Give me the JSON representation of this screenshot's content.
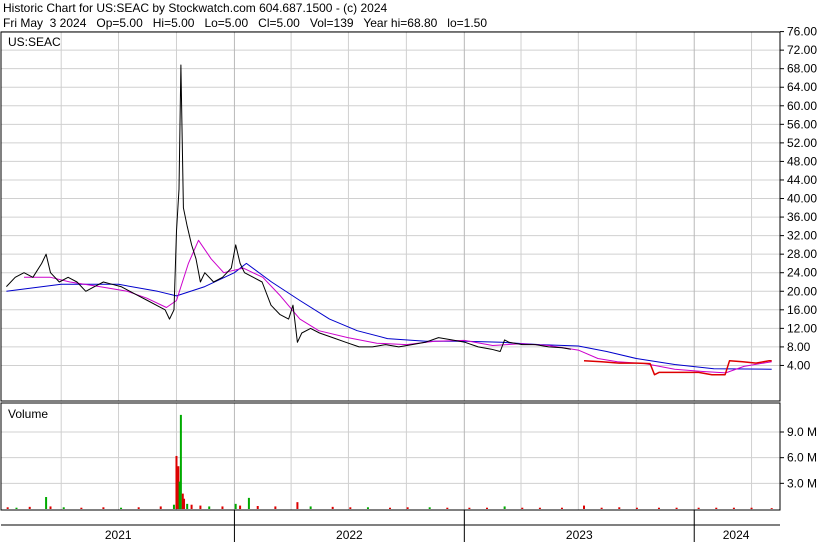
{
  "header": {
    "title": "Historic Chart for US:SEAC by Stockwatch.com 604.687.1500 - (c) 2024",
    "quote": "Fri May  3 2024   Op=5.00   Hi=5.00   Lo=5.00   Cl=5.00   Vol=139   Year hi=68.80   lo=1.50"
  },
  "chart_data": [
    {
      "type": "line",
      "title": "US:SEAC",
      "ylim": [
        0,
        78
      ],
      "y_ticks": [
        "76.00",
        "72.00",
        "68.00",
        "64.00",
        "60.00",
        "56.00",
        "52.00",
        "48.00",
        "44.00",
        "40.00",
        "36.00",
        "32.00",
        "28.00",
        "24.00",
        "20.00",
        "16.00",
        "12.00",
        "8.00",
        "4.00"
      ],
      "x_labels": [
        "2021",
        "2022",
        "2023",
        "2024"
      ],
      "grid": true,
      "colors": {
        "price": "#000000",
        "ma_short": "#cc00cc",
        "ma_long": "#0000cc",
        "red_segment": "#dd0000"
      },
      "price": [
        [
          "2021-01-04",
          21
        ],
        [
          "2021-01-18",
          23
        ],
        [
          "2021-02-01",
          24
        ],
        [
          "2021-02-15",
          23
        ],
        [
          "2021-03-01",
          26
        ],
        [
          "2021-03-08",
          28
        ],
        [
          "2021-03-15",
          24
        ],
        [
          "2021-03-29",
          22
        ],
        [
          "2021-04-12",
          23
        ],
        [
          "2021-04-26",
          22
        ],
        [
          "2021-05-10",
          20
        ],
        [
          "2021-05-24",
          21
        ],
        [
          "2021-06-07",
          22
        ],
        [
          "2021-06-21",
          21.5
        ],
        [
          "2021-07-05",
          21
        ],
        [
          "2021-07-19",
          20
        ],
        [
          "2021-08-02",
          19
        ],
        [
          "2021-08-16",
          18
        ],
        [
          "2021-08-30",
          17
        ],
        [
          "2021-09-13",
          16
        ],
        [
          "2021-09-20",
          14
        ],
        [
          "2021-09-27",
          16
        ],
        [
          "2021-10-01",
          33
        ],
        [
          "2021-10-05",
          42
        ],
        [
          "2021-10-08",
          68.8
        ],
        [
          "2021-10-12",
          38
        ],
        [
          "2021-10-18",
          34
        ],
        [
          "2021-10-25",
          30
        ],
        [
          "2021-11-01",
          27
        ],
        [
          "2021-11-08",
          22
        ],
        [
          "2021-11-15",
          24
        ],
        [
          "2021-11-29",
          22
        ],
        [
          "2021-12-13",
          23
        ],
        [
          "2021-12-27",
          25
        ],
        [
          "2022-01-03",
          30
        ],
        [
          "2022-01-10",
          26
        ],
        [
          "2022-01-17",
          24
        ],
        [
          "2022-01-31",
          23
        ],
        [
          "2022-02-14",
          22
        ],
        [
          "2022-02-28",
          17
        ],
        [
          "2022-03-14",
          15
        ],
        [
          "2022-03-28",
          14
        ],
        [
          "2022-04-04",
          17
        ],
        [
          "2022-04-11",
          9
        ],
        [
          "2022-04-18",
          11
        ],
        [
          "2022-05-02",
          12
        ],
        [
          "2022-05-16",
          11
        ],
        [
          "2022-06-06",
          10
        ],
        [
          "2022-06-27",
          9
        ],
        [
          "2022-07-18",
          8
        ],
        [
          "2022-08-08",
          8
        ],
        [
          "2022-08-29",
          8.5
        ],
        [
          "2022-09-19",
          8
        ],
        [
          "2022-10-10",
          8.5
        ],
        [
          "2022-10-31",
          9
        ],
        [
          "2022-11-21",
          10
        ],
        [
          "2022-12-12",
          9.5
        ],
        [
          "2023-01-02",
          9
        ],
        [
          "2023-01-23",
          8
        ],
        [
          "2023-02-13",
          7.5
        ],
        [
          "2023-02-27",
          7
        ],
        [
          "2023-03-06",
          9.5
        ],
        [
          "2023-03-13",
          9
        ],
        [
          "2023-04-03",
          8.5
        ],
        [
          "2023-04-24",
          8.5
        ],
        [
          "2023-05-15",
          8
        ],
        [
          "2023-06-05",
          7.8
        ],
        [
          "2023-06-19",
          7.5
        ]
      ],
      "price_red": [
        [
          "2023-07-10",
          5
        ],
        [
          "2023-08-07",
          4.8
        ],
        [
          "2023-09-04",
          4.5
        ],
        [
          "2023-10-02",
          4.5
        ],
        [
          "2023-10-23",
          4.4
        ],
        [
          "2023-10-30",
          2
        ],
        [
          "2023-11-06",
          2.5
        ],
        [
          "2023-12-04",
          2.5
        ],
        [
          "2024-01-08",
          2.5
        ],
        [
          "2024-01-29",
          2
        ],
        [
          "2024-02-19",
          2
        ],
        [
          "2024-02-26",
          5
        ],
        [
          "2024-03-18",
          4.8
        ],
        [
          "2024-04-08",
          4.5
        ],
        [
          "2024-04-29",
          5
        ],
        [
          "2024-05-03",
          5
        ]
      ],
      "ma_short": [
        [
          "2021-02-01",
          23
        ],
        [
          "2021-03-15",
          23
        ],
        [
          "2021-04-15",
          22
        ],
        [
          "2021-06-01",
          21
        ],
        [
          "2021-07-15",
          20
        ],
        [
          "2021-08-15",
          18.5
        ],
        [
          "2021-09-15",
          16.5
        ],
        [
          "2021-10-01",
          18
        ],
        [
          "2021-10-20",
          26
        ],
        [
          "2021-11-05",
          31
        ],
        [
          "2021-11-25",
          27
        ],
        [
          "2021-12-15",
          24
        ],
        [
          "2022-01-15",
          25
        ],
        [
          "2022-02-15",
          23
        ],
        [
          "2022-03-15",
          19
        ],
        [
          "2022-04-15",
          14
        ],
        [
          "2022-05-15",
          11.5
        ],
        [
          "2022-06-30",
          10
        ],
        [
          "2022-08-15",
          8.8
        ],
        [
          "2022-10-01",
          8.5
        ],
        [
          "2022-11-15",
          9.2
        ],
        [
          "2023-01-01",
          9.4
        ],
        [
          "2023-02-15",
          8.3
        ],
        [
          "2023-04-01",
          8.7
        ],
        [
          "2023-05-15",
          8.3
        ],
        [
          "2023-07-01",
          7.3
        ],
        [
          "2023-08-01",
          5.5
        ],
        [
          "2023-09-01",
          4.8
        ],
        [
          "2023-10-15",
          4.4
        ],
        [
          "2023-12-01",
          3.2
        ],
        [
          "2024-01-15",
          2.7
        ],
        [
          "2024-02-20",
          2.4
        ],
        [
          "2024-03-20",
          3.8
        ],
        [
          "2024-05-03",
          4.8
        ]
      ],
      "ma_long": [
        [
          "2021-01-04",
          20
        ],
        [
          "2021-04-01",
          21.5
        ],
        [
          "2021-07-01",
          21.5
        ],
        [
          "2021-09-01",
          20
        ],
        [
          "2021-10-01",
          19
        ],
        [
          "2021-11-15",
          21
        ],
        [
          "2022-01-01",
          24
        ],
        [
          "2022-01-20",
          26
        ],
        [
          "2022-03-01",
          22
        ],
        [
          "2022-04-15",
          18
        ],
        [
          "2022-06-01",
          14
        ],
        [
          "2022-07-15",
          11.5
        ],
        [
          "2022-09-01",
          9.8
        ],
        [
          "2022-11-01",
          9.2
        ],
        [
          "2023-01-01",
          9.2
        ],
        [
          "2023-03-01",
          9
        ],
        [
          "2023-05-01",
          8.5
        ],
        [
          "2023-07-01",
          8.2
        ],
        [
          "2023-08-15",
          7
        ],
        [
          "2023-10-01",
          5.5
        ],
        [
          "2023-12-01",
          4.2
        ],
        [
          "2024-02-01",
          3.3
        ],
        [
          "2024-05-03",
          3.2
        ]
      ]
    },
    {
      "type": "bar",
      "title": "Volume",
      "ylim": [
        0,
        11500000
      ],
      "y_ticks": [
        "9.0 M",
        "6.0 M",
        "3.0 M"
      ],
      "grid": true,
      "colors": {
        "up": "#00aa00",
        "down": "#dd0000"
      },
      "bars": [
        [
          "2021-01-06",
          200000,
          "down"
        ],
        [
          "2021-01-20",
          150000,
          "up"
        ],
        [
          "2021-02-10",
          250000,
          "down"
        ],
        [
          "2021-03-08",
          1400000,
          "up"
        ],
        [
          "2021-03-15",
          300000,
          "down"
        ],
        [
          "2021-04-05",
          200000,
          "up"
        ],
        [
          "2021-05-03",
          150000,
          "down"
        ],
        [
          "2021-06-07",
          200000,
          "down"
        ],
        [
          "2021-07-05",
          150000,
          "up"
        ],
        [
          "2021-08-02",
          200000,
          "down"
        ],
        [
          "2021-09-06",
          300000,
          "down"
        ],
        [
          "2021-09-27",
          500000,
          "up"
        ],
        [
          "2021-10-01",
          6200000,
          "down"
        ],
        [
          "2021-10-04",
          5000000,
          "down"
        ],
        [
          "2021-10-06",
          3200000,
          "up"
        ],
        [
          "2021-10-08",
          11000000,
          "up"
        ],
        [
          "2021-10-11",
          1800000,
          "down"
        ],
        [
          "2021-10-13",
          1200000,
          "down"
        ],
        [
          "2021-10-18",
          600000,
          "up"
        ],
        [
          "2021-10-25",
          500000,
          "down"
        ],
        [
          "2021-11-08",
          400000,
          "down"
        ],
        [
          "2021-11-22",
          300000,
          "up"
        ],
        [
          "2021-12-13",
          300000,
          "down"
        ],
        [
          "2022-01-03",
          600000,
          "up"
        ],
        [
          "2022-01-10",
          400000,
          "down"
        ],
        [
          "2022-01-24",
          1300000,
          "up"
        ],
        [
          "2022-02-07",
          350000,
          "down"
        ],
        [
          "2022-03-07",
          300000,
          "down"
        ],
        [
          "2022-04-11",
          800000,
          "down"
        ],
        [
          "2022-05-02",
          300000,
          "up"
        ],
        [
          "2022-06-06",
          250000,
          "down"
        ],
        [
          "2022-07-04",
          200000,
          "down"
        ],
        [
          "2022-08-01",
          200000,
          "up"
        ],
        [
          "2022-09-05",
          150000,
          "down"
        ],
        [
          "2022-10-03",
          200000,
          "down"
        ],
        [
          "2022-11-07",
          200000,
          "up"
        ],
        [
          "2022-12-05",
          150000,
          "down"
        ],
        [
          "2023-01-09",
          150000,
          "down"
        ],
        [
          "2023-02-06",
          150000,
          "down"
        ],
        [
          "2023-03-06",
          300000,
          "up"
        ],
        [
          "2023-04-03",
          150000,
          "down"
        ],
        [
          "2023-05-01",
          150000,
          "down"
        ],
        [
          "2023-06-05",
          150000,
          "down"
        ],
        [
          "2023-07-10",
          400000,
          "down"
        ],
        [
          "2023-08-07",
          150000,
          "down"
        ],
        [
          "2023-09-04",
          200000,
          "down"
        ],
        [
          "2023-10-02",
          150000,
          "down"
        ],
        [
          "2023-11-06",
          150000,
          "down"
        ],
        [
          "2023-12-04",
          150000,
          "down"
        ],
        [
          "2024-01-08",
          150000,
          "down"
        ],
        [
          "2024-02-05",
          150000,
          "down"
        ],
        [
          "2024-03-04",
          150000,
          "down"
        ],
        [
          "2024-04-01",
          150000,
          "down"
        ],
        [
          "2024-05-03",
          100000,
          "down"
        ]
      ]
    }
  ]
}
